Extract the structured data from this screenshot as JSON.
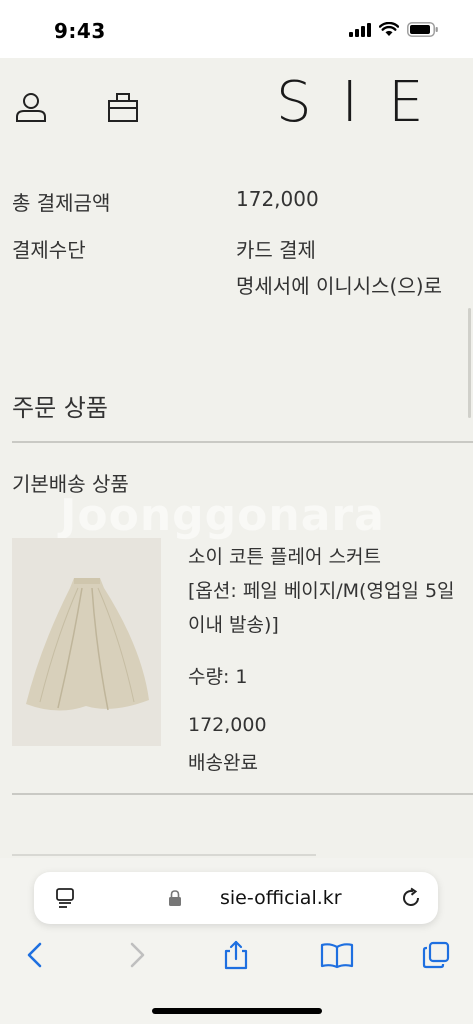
{
  "status_bar": {
    "time": "9:43"
  },
  "header": {
    "brand": "SIE"
  },
  "payment": {
    "total_label": "총 결제금액",
    "total_value": "172,000",
    "method_label": "결제수단",
    "method_value": "카드 결제",
    "method_note": "명세서에 이니시스(으)로"
  },
  "order": {
    "section_title": "주문 상품",
    "shipping_group": "기본배송 상품",
    "items": [
      {
        "name": "소이 코튼 플레어 스커트",
        "option_line1": "[옵션: 페일 베이지/M(영업일 5일",
        "option_line2": "이내 발송)]",
        "quantity": "수량: 1",
        "price": "172,000",
        "status": "배송완료"
      }
    ]
  },
  "watermark": "Joonggonara",
  "browser": {
    "url": "sie-official.kr"
  },
  "colors": {
    "background": "#f1f1ec",
    "accent": "#1e6fe0",
    "skirt": "#d9d1bd"
  }
}
